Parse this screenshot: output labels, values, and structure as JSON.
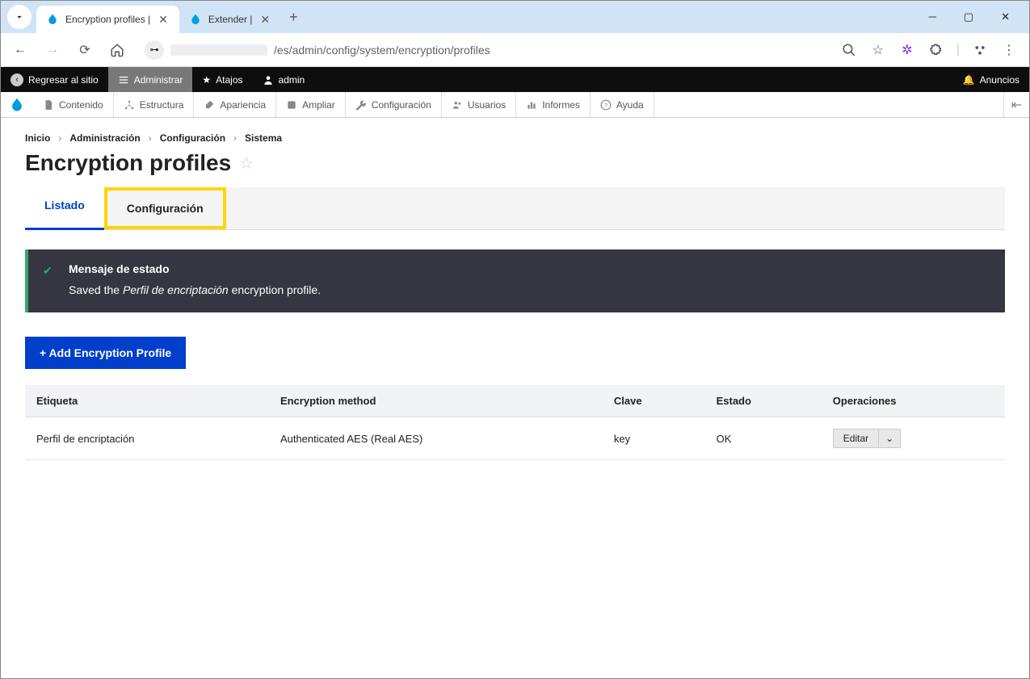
{
  "browser": {
    "tabs": [
      {
        "title": "Encryption profiles |",
        "active": true
      },
      {
        "title": "Extender |",
        "active": false
      }
    ],
    "url_path": "/es/admin/config/system/encryption/profiles"
  },
  "drupal_toolbar": {
    "back": "Regresar al sitio",
    "manage": "Administrar",
    "shortcuts": "Atajos",
    "user": "admin",
    "announcements": "Anuncios"
  },
  "admin_menu": {
    "items": [
      "Contenido",
      "Estructura",
      "Apariencia",
      "Ampliar",
      "Configuración",
      "Usuarios",
      "Informes",
      "Ayuda"
    ]
  },
  "breadcrumb": [
    "Inicio",
    "Administración",
    "Configuración",
    "Sistema"
  ],
  "page_title": "Encryption profiles",
  "tabs": {
    "listado": "Listado",
    "configuracion": "Configuración"
  },
  "status": {
    "heading": "Mensaje de estado",
    "prefix": "Saved the ",
    "em": "Perfil de encriptación",
    "suffix": " encryption profile."
  },
  "add_button": "+ Add Encryption Profile",
  "table": {
    "headers": {
      "label": "Etiqueta",
      "method": "Encryption method",
      "key": "Clave",
      "status": "Estado",
      "ops": "Operaciones"
    },
    "rows": [
      {
        "label": "Perfil de encriptación",
        "method": "Authenticated AES (Real AES)",
        "key": "key",
        "status": "OK",
        "op": "Editar"
      }
    ]
  }
}
